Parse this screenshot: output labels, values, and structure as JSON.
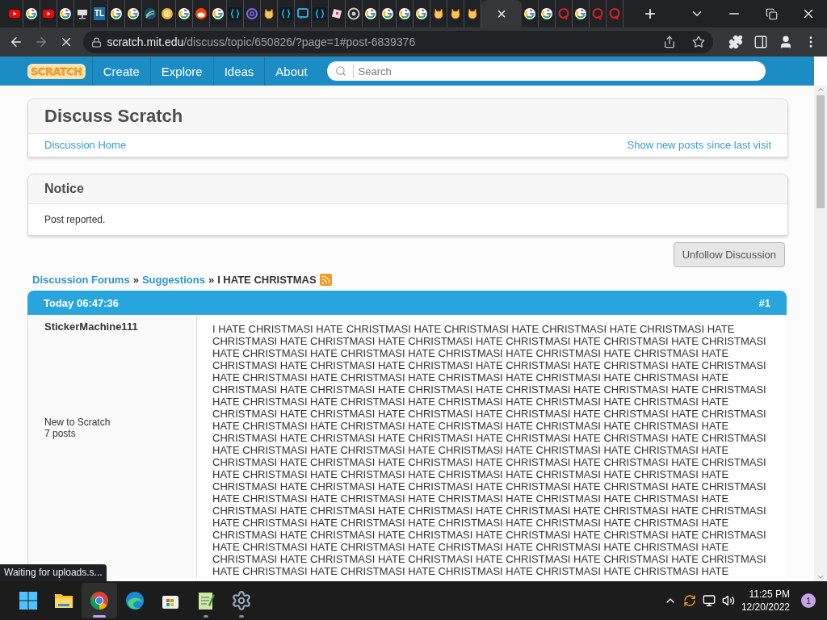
{
  "browser": {
    "tabs": [
      {
        "kind": "youtube",
        "selected": false
      },
      {
        "kind": "google",
        "selected": false
      },
      {
        "kind": "youtube",
        "selected": false
      },
      {
        "kind": "google",
        "selected": false
      },
      {
        "kind": "monitor",
        "selected": false
      },
      {
        "kind": "text",
        "label": "TL",
        "selected": false
      },
      {
        "kind": "google",
        "selected": false
      },
      {
        "kind": "google",
        "selected": false
      },
      {
        "kind": "wave",
        "selected": false
      },
      {
        "kind": "grid",
        "selected": false
      },
      {
        "kind": "google",
        "selected": false
      },
      {
        "kind": "reddit",
        "selected": false
      },
      {
        "kind": "google",
        "selected": false
      },
      {
        "kind": "braces",
        "selected": false
      },
      {
        "kind": "at",
        "selected": false
      },
      {
        "kind": "cat",
        "selected": false
      },
      {
        "kind": "braces",
        "selected": false
      },
      {
        "kind": "chat",
        "selected": false
      },
      {
        "kind": "braces",
        "selected": false
      },
      {
        "kind": "diamond",
        "selected": false
      },
      {
        "kind": "chrome",
        "selected": false
      },
      {
        "kind": "google",
        "selected": false
      },
      {
        "kind": "google",
        "selected": false
      },
      {
        "kind": "google",
        "selected": false
      },
      {
        "kind": "google",
        "selected": false
      },
      {
        "kind": "cat",
        "selected": false
      },
      {
        "kind": "cat",
        "selected": false
      },
      {
        "kind": "cat",
        "selected": false
      },
      {
        "kind": "close",
        "close": "×",
        "selected": true
      },
      {
        "kind": "google",
        "selected": false
      },
      {
        "kind": "google",
        "selected": false
      },
      {
        "kind": "quora",
        "selected": false
      },
      {
        "kind": "google",
        "selected": false
      },
      {
        "kind": "quora",
        "selected": false
      },
      {
        "kind": "quora",
        "selected": false
      }
    ],
    "new_tab": "+",
    "address": {
      "host": "scratch.mit.edu",
      "path": "/discuss/topic/650826/?page=1#post-6839376"
    },
    "loading": true,
    "status": "Waiting for uploads.s..."
  },
  "site_nav": {
    "logo": "SCRATCH",
    "items": [
      "Create",
      "Explore",
      "Ideas",
      "About"
    ],
    "search": {
      "placeholder": "Search"
    }
  },
  "header_box": {
    "title": "Discuss Scratch",
    "links": [
      "Discussion Home",
      "Show new posts since last visit"
    ]
  },
  "notice": {
    "title": "Notice",
    "text": "Post reported."
  },
  "follow_button": "Unfollow Discussion",
  "breadcrumb": {
    "links": [
      "Discussion Forums",
      "Suggestions"
    ],
    "separator": "»",
    "current": "I HATE CHRISTMAS"
  },
  "post": {
    "time": "Today 06:47:36",
    "number": "#1",
    "author": "StickerMachine111",
    "rank": "New to Scratch",
    "posts": "7 posts",
    "body": "I HATE CHRISTMASI HATE CHRISTMASI HATE CHRISTMASI HATE CHRISTMASI HATE CHRISTMASI HATE CHRISTMASI HATE CHRISTMASI HATE CHRISTMASI HATE CHRISTMASI HATE CHRISTMASI HATE CHRISTMASI HATE CHRISTMASI HATE CHRISTMASI HATE CHRISTMASI HATE CHRISTMASI HATE CHRISTMASI HATE CHRISTMASI HATE CHRISTMASI HATE CHRISTMASI HATE CHRISTMASI HATE CHRISTMASI HATE CHRISTMASI HATE CHRISTMASI HATE CHRISTMASI HATE CHRISTMASI HATE CHRISTMASI HATE CHRISTMASI HATE CHRISTMASI HATE CHRISTMASI HATE CHRISTMASI HATE CHRISTMASI HATE CHRISTMASI HATE CHRISTMASI HATE CHRISTMASI HATE CHRISTMASI HATE CHRISTMASI HATE CHRISTMASI HATE CHRISTMASI HATE CHRISTMASI HATE CHRISTMASI HATE CHRISTMASI HATE CHRISTMASI HATE CHRISTMASI HATE CHRISTMASI HATE CHRISTMASI HATE CHRISTMASI HATE CHRISTMASI HATE CHRISTMASI HATE CHRISTMASI HATE CHRISTMASI HATE CHRISTMASI HATE CHRISTMASI HATE CHRISTMASI HATE CHRISTMASI HATE CHRISTMASI HATE CHRISTMASI HATE CHRISTMASI HATE CHRISTMASI HATE CHRISTMASI HATE CHRISTMASI HATE CHRISTMASI HATE CHRISTMASI HATE CHRISTMASI HATE CHRISTMASI HATE CHRISTMASI HATE CHRISTMASI HATE CHRISTMASI HATE CHRISTMASI HATE CHRISTMASI HATE CHRISTMASI HATE CHRISTMASI HATE CHRISTMASI HATE CHRISTMASI HATE CHRISTMASI HATE CHRISTMASI HATE CHRISTMASI HATE CHRISTMASI HATE CHRISTMASI HATE CHRISTMASI HATE CHRISTMASI HATE CHRISTMASI HATE CHRISTMASI HATE CHRISTMASI HATE CHRISTMASI HATE CHRISTMASI HATE CHRISTMASI HATE CHRISTMASI HATE CHRISTMASI HATE CHRISTMASI HATE CHRISTMASI HATE CHRISTMASI HATE CHRISTMASI HATE CHRISTMASI HATE CHRISTMASI HATE CHRISTMASI HATE CHRISTMASI HATE CHRISTMASI HATE CHRISTMASI HATE CHRISTMASI HATE CHRISTMASI HATE CHRISTMASI HATE CHRISTMASI HATE CHRISTMASI HATE CHRISTMASI HATE CHRISTMASI HATE CHRISTMASI HATE CHRISTMASI HATE CHRISTMASI HATE CHRISTMASI HATE CHRISTMASI HATE CHRISTMASI HATE CHRISTMASI HATE CHRISTMASI HATE CHRISTMASI HATE CHRISTMASI HATE"
  },
  "taskbar": {
    "apps": [
      {
        "kind": "start",
        "selected": false,
        "running": false
      },
      {
        "kind": "folder",
        "selected": false,
        "running": false
      },
      {
        "kind": "chrome",
        "selected": true,
        "running": true
      },
      {
        "kind": "edge",
        "selected": false,
        "running": false
      },
      {
        "kind": "store",
        "selected": false,
        "running": false
      },
      {
        "kind": "notepad",
        "selected": false,
        "running": true
      },
      {
        "kind": "settings",
        "selected": false,
        "running": true
      }
    ],
    "time": "11:25 PM",
    "date": "12/20/2022",
    "notifications": "1"
  }
}
